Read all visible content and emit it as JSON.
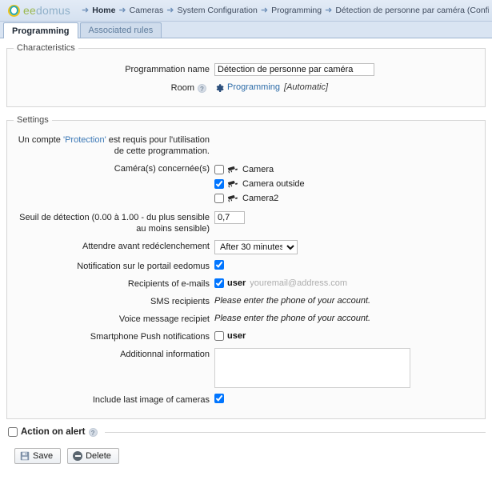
{
  "header": {
    "logo_text_1": "ee",
    "logo_text_2": "domus",
    "breadcrumbs": [
      {
        "label": "Home",
        "bold": true
      },
      {
        "label": "Cameras",
        "bold": false
      },
      {
        "label": "System Configuration",
        "bold": false
      },
      {
        "label": "Programming",
        "bold": false
      },
      {
        "label": "Détection de personne par caméra (Configuration)",
        "bold": false
      }
    ]
  },
  "tabs": [
    {
      "label": "Programming",
      "active": true
    },
    {
      "label": "Associated rules",
      "active": false
    }
  ],
  "characteristics": {
    "legend": "Characteristics",
    "programmation_name_label": "Programmation name",
    "programmation_name_value": "Détection de personne par caméra",
    "room_label": "Room",
    "room_help": "?",
    "room_link": "Programming",
    "room_mode": "[Automatic]"
  },
  "settings": {
    "legend": "Settings",
    "account_note_1": "Un compte ",
    "account_note_protection": "'Protection'",
    "account_note_2": " est requis pour l'utilisation de cette programmation.",
    "cameras_label": "Caméra(s) concernée(s)",
    "cameras": [
      {
        "name": "Camera",
        "checked": false
      },
      {
        "name": "Camera outside",
        "checked": true
      },
      {
        "name": "Camera2",
        "checked": false
      }
    ],
    "threshold_label": "Seuil de détection (0.00 à 1.00 - du plus sensible au moins sensible)",
    "threshold_value": "0,7",
    "retrigger_label": "Attendre avant redéclenchement",
    "retrigger_value": "After 30 minutes",
    "retrigger_options": [
      "After 30 minutes"
    ],
    "portal_notification_label": "Notification sur le portail eedomus",
    "portal_notification_checked": true,
    "email_label": "Recipients of e-mails",
    "email_user": "user",
    "email_placeholder": "youremail@address.com",
    "email_checked": true,
    "sms_label": "SMS recipients",
    "sms_value": "Please enter the phone of your account.",
    "voice_label": "Voice message recipiet",
    "voice_value": "Please enter the phone of your account.",
    "push_label": "Smartphone Push notifications",
    "push_user": "user",
    "push_checked": false,
    "additional_label": "Additionnal information",
    "additional_value": "",
    "include_image_label": "Include last image of cameras",
    "include_image_checked": true
  },
  "action_on_alert": {
    "label": "Action on alert",
    "help": "?",
    "checked": false
  },
  "footer": {
    "save_label": "Save",
    "delete_label": "Delete"
  }
}
